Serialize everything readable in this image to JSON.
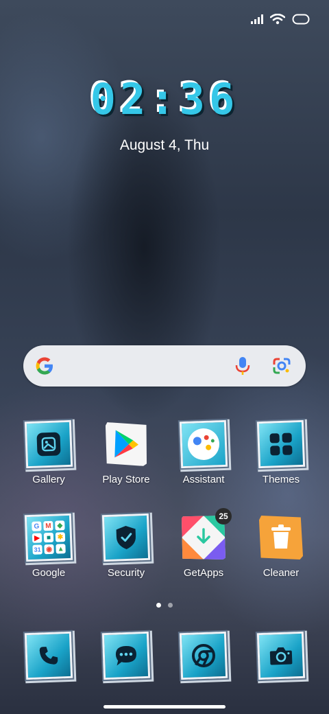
{
  "status_bar": {
    "icons": [
      "signal-icon",
      "wifi-icon",
      "battery-icon"
    ]
  },
  "lock_clock": {
    "time": "02:36",
    "date": "August 4, Thu"
  },
  "search_widget": {
    "icons": [
      "google-logo-icon",
      "microphone-icon",
      "google-lens-icon"
    ]
  },
  "apps_row1": [
    {
      "label": "Gallery",
      "icon": "gallery-icon"
    },
    {
      "label": "Play Store",
      "icon": "play-store-icon"
    },
    {
      "label": "Assistant",
      "icon": "assistant-icon"
    },
    {
      "label": "Themes",
      "icon": "themes-icon"
    }
  ],
  "apps_row2": [
    {
      "label": "Google",
      "icon": "google-folder-icon"
    },
    {
      "label": "Security",
      "icon": "security-icon"
    },
    {
      "label": "GetApps",
      "icon": "getapps-icon",
      "badge": "25"
    },
    {
      "label": "Cleaner",
      "icon": "cleaner-icon"
    }
  ],
  "page_indicator": {
    "pages": 2,
    "active": 1
  },
  "dock": [
    {
      "icon": "phone-icon"
    },
    {
      "icon": "messages-icon"
    },
    {
      "icon": "chrome-icon"
    },
    {
      "icon": "camera-icon"
    }
  ],
  "colors": {
    "clock_accent": "#35c7e8",
    "icon_frame": "#1aa3c8",
    "search_bg": "#e9ebef"
  }
}
